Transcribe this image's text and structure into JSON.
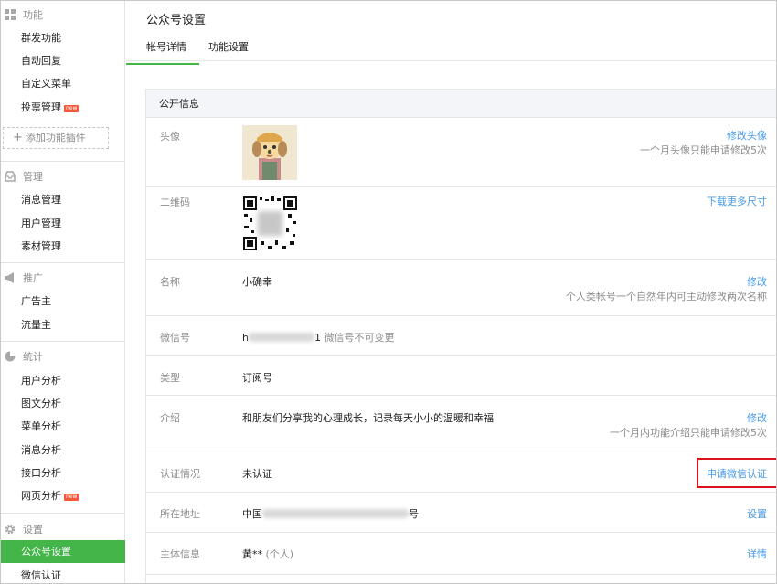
{
  "sidebar": {
    "sections": [
      {
        "title": "功能",
        "icon": "grid-icon",
        "items": [
          {
            "label": "群发功能"
          },
          {
            "label": "自动回复"
          },
          {
            "label": "自定义菜单"
          },
          {
            "label": "投票管理",
            "badge": "new"
          }
        ],
        "add_plugin": "添加功能插件"
      },
      {
        "title": "管理",
        "icon": "inbox-icon",
        "items": [
          {
            "label": "消息管理"
          },
          {
            "label": "用户管理"
          },
          {
            "label": "素材管理"
          }
        ]
      },
      {
        "title": "推广",
        "icon": "megaphone-icon",
        "items": [
          {
            "label": "广告主"
          },
          {
            "label": "流量主"
          }
        ]
      },
      {
        "title": "统计",
        "icon": "pie-chart-icon",
        "items": [
          {
            "label": "用户分析"
          },
          {
            "label": "图文分析"
          },
          {
            "label": "菜单分析"
          },
          {
            "label": "消息分析"
          },
          {
            "label": "接口分析"
          },
          {
            "label": "网页分析",
            "badge": "new"
          }
        ]
      },
      {
        "title": "设置",
        "icon": "gear-icon",
        "items": [
          {
            "label": "公众号设置",
            "active": true
          },
          {
            "label": "微信认证"
          }
        ]
      }
    ]
  },
  "header": {
    "title": "公众号设置",
    "tabs": [
      {
        "label": "帐号详情",
        "active": true
      },
      {
        "label": "功能设置"
      }
    ]
  },
  "public_info": {
    "title": "公开信息",
    "avatar": {
      "label": "头像",
      "action": "修改头像",
      "note": "一个月头像只能申请修改5次"
    },
    "qrcode": {
      "label": "二维码",
      "action": "下载更多尺寸"
    },
    "name": {
      "label": "名称",
      "value": "小确幸",
      "action": "修改",
      "note": "个人类帐号一个自然年内可主动修改两次名称"
    },
    "wechat_id": {
      "label": "微信号",
      "value_start": "h",
      "value_end": "1",
      "note": "微信号不可变更"
    },
    "type": {
      "label": "类型",
      "value": "订阅号"
    },
    "intro": {
      "label": "介绍",
      "value": "和朋友们分享我的心理成长，记录每天小小的温暖和幸福",
      "action": "修改",
      "note": "一个月内功能介绍只能申请修改5次"
    },
    "verification": {
      "label": "认证情况",
      "value": "未认证",
      "action": "申请微信认证"
    },
    "address": {
      "label": "所在地址",
      "value_start": "中国",
      "value_end": "号",
      "action": "设置"
    },
    "subject": {
      "label": "主体信息",
      "value": "黄**",
      "value_suffix": "(个人)",
      "action": "详情"
    }
  }
}
